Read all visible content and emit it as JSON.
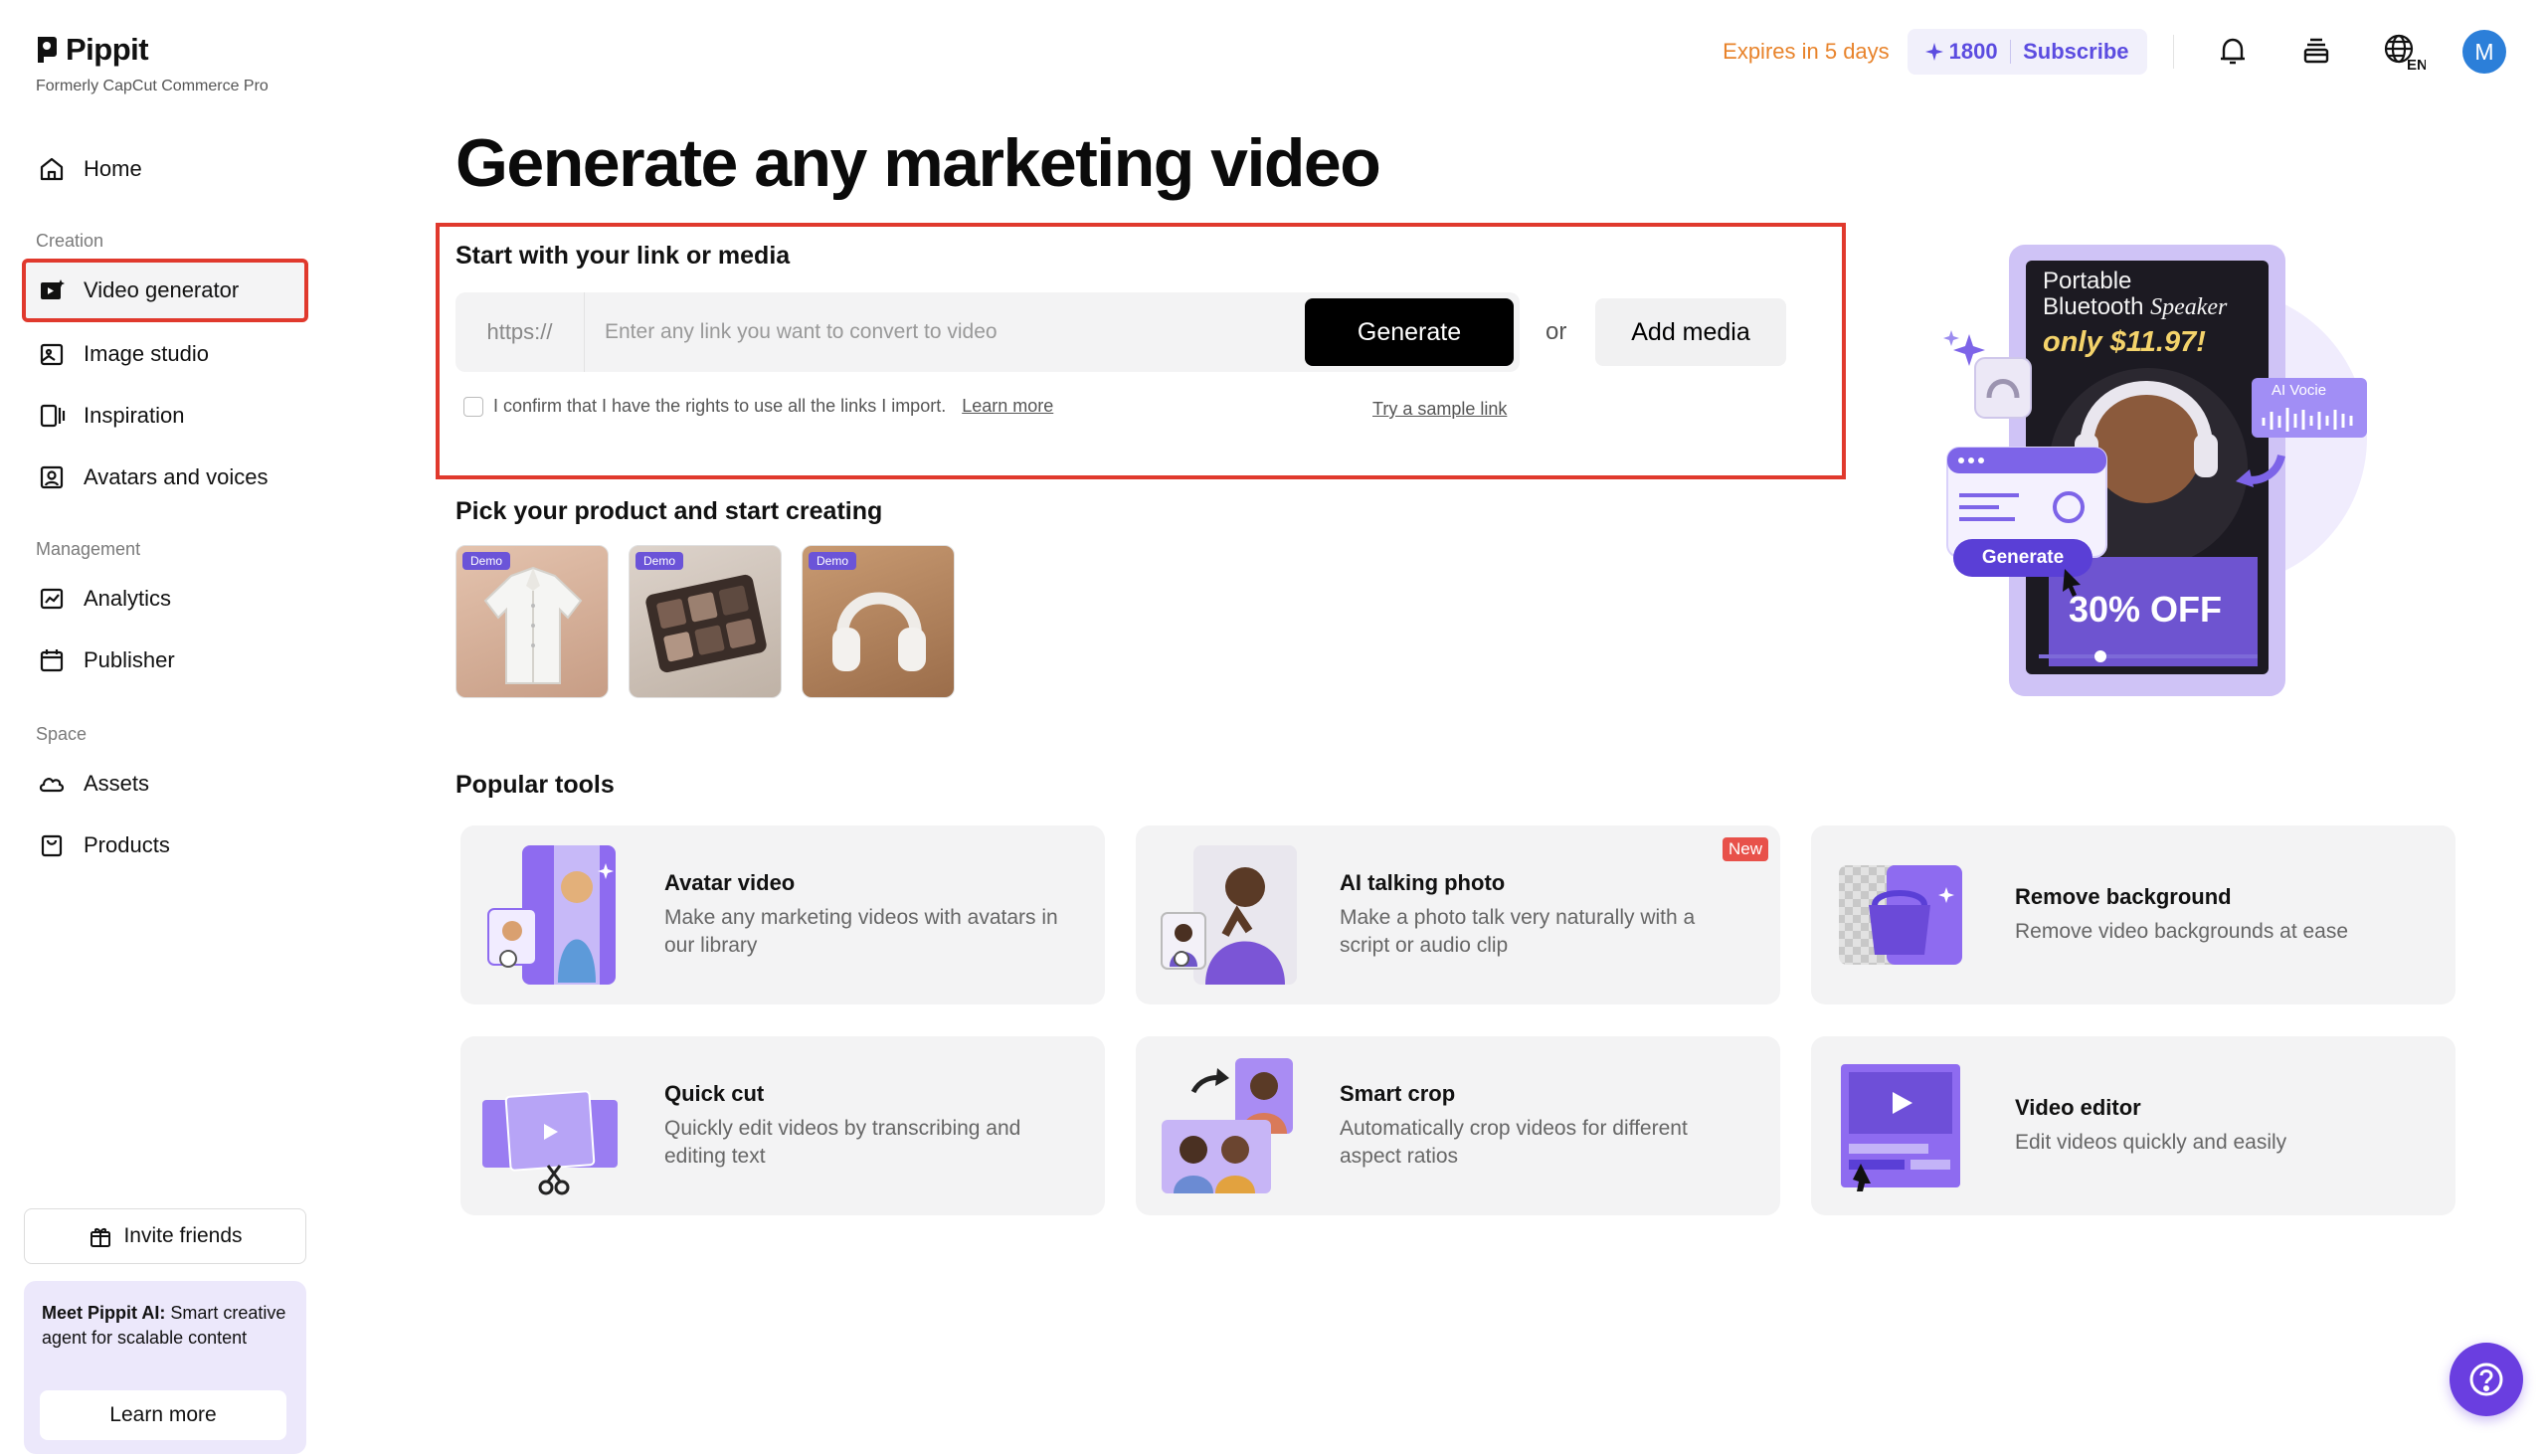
{
  "brand": {
    "name": "Pippit",
    "subtitle": "Formerly CapCut Commerce Pro"
  },
  "sidebar": {
    "home": "Home",
    "sections": {
      "creation": "Creation",
      "management": "Management",
      "space": "Space"
    },
    "creation_items": [
      {
        "label": "Video generator",
        "icon": "video-generator-icon",
        "active": true
      },
      {
        "label": "Image studio",
        "icon": "image-studio-icon"
      },
      {
        "label": "Inspiration",
        "icon": "inspiration-icon"
      },
      {
        "label": "Avatars and voices",
        "icon": "avatar-voice-icon"
      }
    ],
    "management_items": [
      {
        "label": "Analytics",
        "icon": "analytics-icon"
      },
      {
        "label": "Publisher",
        "icon": "calendar-icon"
      }
    ],
    "space_items": [
      {
        "label": "Assets",
        "icon": "cloud-icon"
      },
      {
        "label": "Products",
        "icon": "products-icon"
      }
    ],
    "invite": "Invite friends",
    "promo": {
      "bold": "Meet Pippit AI:",
      "text": " Smart creative agent for scalable content",
      "button": "Learn more"
    }
  },
  "topbar": {
    "expires": "Expires in 5 days",
    "credits": "1800",
    "subscribe": "Subscribe",
    "language": "EN",
    "avatar_initial": "M"
  },
  "main": {
    "title": "Generate any marketing video",
    "link_section": {
      "heading": "Start with your link or media",
      "prefix": "https://",
      "placeholder": "Enter any link you want to convert to video",
      "value": "",
      "generate": "Generate",
      "or": "or",
      "add_media": "Add media",
      "confirm_text": "I confirm that I have the rights to use all the links I import.",
      "learn_more": "Learn more",
      "sample_link": "Try a sample link"
    },
    "pick_heading": "Pick your product and start creating",
    "products": [
      {
        "badge": "Demo",
        "name": "shirt"
      },
      {
        "badge": "Demo",
        "name": "eyeshadow-palette"
      },
      {
        "badge": "Demo",
        "name": "headphones"
      }
    ],
    "hero": {
      "line1": "Portable",
      "line2a": "Bluetooth ",
      "line2b": "Speaker",
      "price": "only $11.97!",
      "discount": "30% OFF",
      "ai_voice": "AI Vocie",
      "generate": "Generate"
    },
    "popular_heading": "Popular tools",
    "tools": [
      {
        "title": "Avatar video",
        "desc": "Make any marketing videos with avatars in our library",
        "new": ""
      },
      {
        "title": "AI talking photo",
        "desc": "Make a photo talk very naturally with a script or audio clip",
        "new": "New"
      },
      {
        "title": "Remove background",
        "desc": "Remove video backgrounds at ease",
        "new": ""
      },
      {
        "title": "Quick cut",
        "desc": "Quickly edit videos by transcribing and editing text",
        "new": ""
      },
      {
        "title": "Smart crop",
        "desc": "Automatically crop videos for different aspect ratios",
        "new": ""
      },
      {
        "title": "Video editor",
        "desc": "Edit videos quickly and easily",
        "new": ""
      }
    ]
  },
  "colors": {
    "accent": "#5b4ce0",
    "highlight_border": "#e0392d",
    "expires": "#e8832b",
    "help_button": "#6a3ee0"
  }
}
